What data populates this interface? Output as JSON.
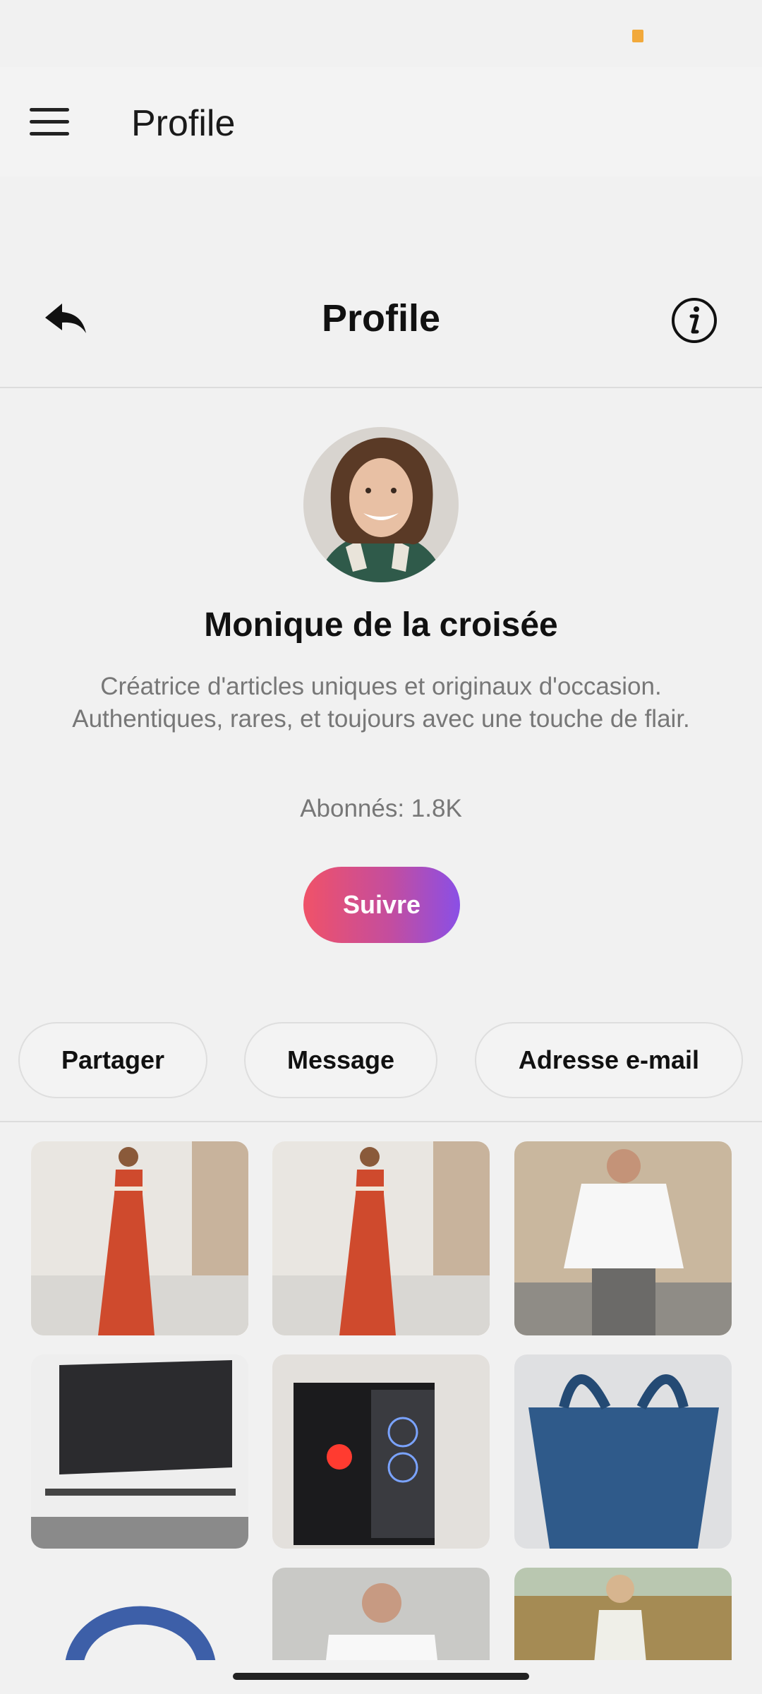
{
  "appbar": {
    "title": "Profile"
  },
  "header": {
    "title": "Profile"
  },
  "profile": {
    "name": "Monique de la croisée",
    "bio": "Créatrice d'articles uniques et originaux d'occasion. Authentiques, rares, et toujours avec une touche de flair.",
    "followers": "Abonnés: 1.8K",
    "follow_label": "Suivre"
  },
  "actions": {
    "share": "Partager",
    "message": "Message",
    "email": "Adresse e-mail"
  },
  "colors": {
    "follow_gradient": [
      "#f05268",
      "#8a4fe6"
    ],
    "status_dot": "#f2a93b"
  },
  "icons": [
    "menu-icon",
    "back-icon",
    "info-icon"
  ],
  "products": [
    "red-dress-photo",
    "red-dress-photo",
    "white-shirt-man-photo",
    "tv-photo",
    "pc-tower-photo",
    "blue-bag-photo",
    "headphones-photo",
    "white-shirt-photo",
    "floral-dress-photo"
  ]
}
